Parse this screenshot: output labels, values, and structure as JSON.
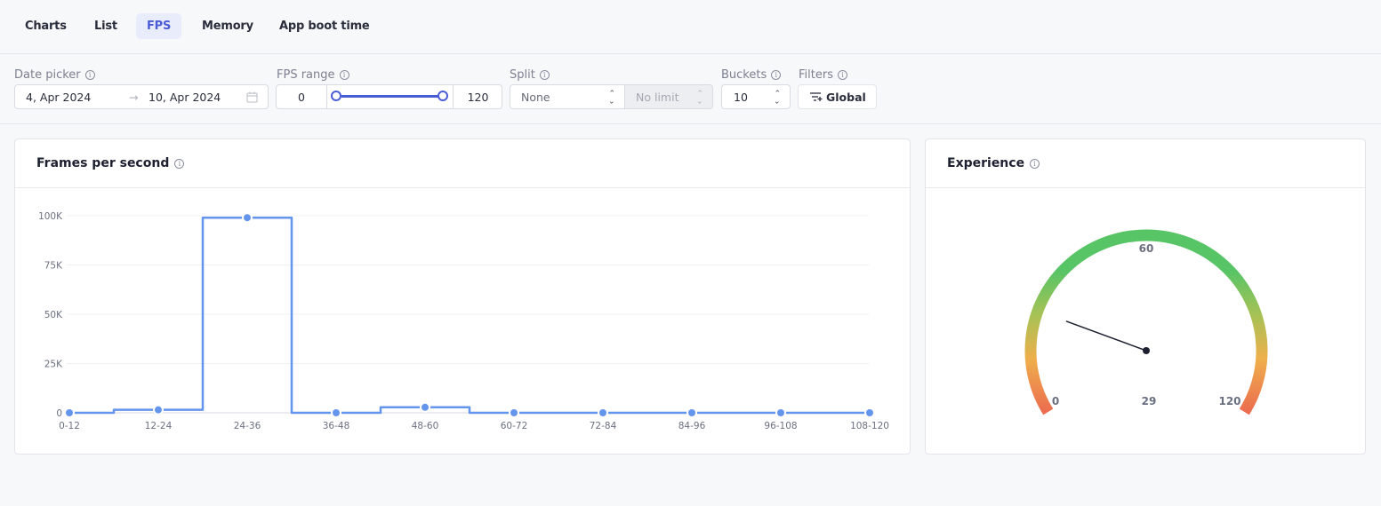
{
  "tabs": [
    {
      "label": "Charts",
      "active": false
    },
    {
      "label": "List",
      "active": false
    },
    {
      "label": "FPS",
      "active": true
    },
    {
      "label": "Memory",
      "active": false
    },
    {
      "label": "App boot time",
      "active": false
    }
  ],
  "filters": {
    "date_picker": {
      "label": "Date picker",
      "start": "4, Apr 2024",
      "arrow": "→",
      "end": "10, Apr 2024"
    },
    "fps_range": {
      "label": "FPS range",
      "min": "0",
      "max": "120",
      "low_fraction": 0,
      "high_fraction": 1
    },
    "split": {
      "label": "Split",
      "value": "None",
      "limit": "No limit"
    },
    "buckets": {
      "label": "Buckets",
      "value": "10"
    },
    "filters": {
      "label": "Filters",
      "button": "Global"
    }
  },
  "fps_card": {
    "title": "Frames per second"
  },
  "experience_card": {
    "title": "Experience"
  },
  "colors": {
    "accent": "#4a5bd6",
    "line": "#6495ed",
    "gauge_low": "#ec6d4f",
    "gauge_mid": "#eeaf4c",
    "gauge_high": "#57c466"
  },
  "chart_data": [
    {
      "type": "line",
      "title": "Frames per second",
      "step": true,
      "categories": [
        "0-12",
        "12-24",
        "24-36",
        "36-48",
        "48-60",
        "60-72",
        "72-84",
        "84-96",
        "96-108",
        "108-120"
      ],
      "values": [
        0,
        1500,
        99000,
        0,
        2800,
        0,
        0,
        0,
        0,
        0
      ],
      "yticks": [
        0,
        25000,
        50000,
        75000,
        100000
      ],
      "ytick_labels": [
        "0",
        "25K",
        "50K",
        "75K",
        "100K"
      ],
      "ylim": [
        0,
        100000
      ],
      "grid": true,
      "xlabel": "",
      "ylabel": ""
    },
    {
      "type": "gauge",
      "title": "Experience",
      "min": 0,
      "max": 120,
      "mid_label": "60",
      "value": 29,
      "labels": [
        "0",
        "60",
        "120"
      ],
      "value_label": "29"
    }
  ]
}
